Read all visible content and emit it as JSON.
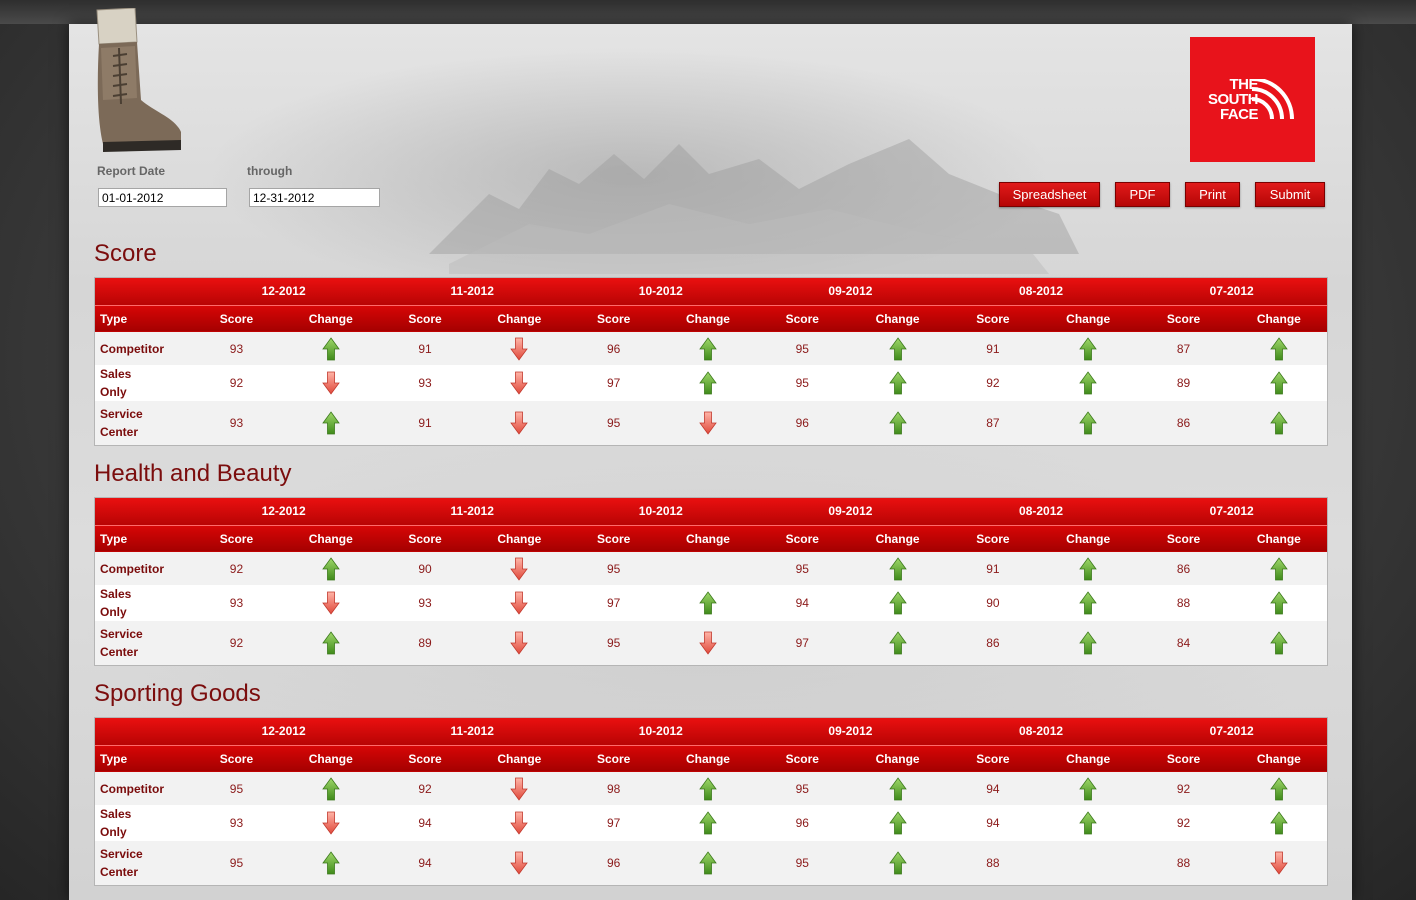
{
  "brand": {
    "logo_lines": [
      "THE",
      "SOUTH",
      "FACE"
    ],
    "color": "#e8131b"
  },
  "report": {
    "date_label": "Report Date",
    "through_label": "through",
    "start_date": "01-01-2012",
    "end_date": "12-31-2012"
  },
  "toolbar": {
    "spreadsheet": "Spreadsheet",
    "pdf": "PDF",
    "print": "Print",
    "submit": "Submit"
  },
  "columns": {
    "type": "Type",
    "score": "Score",
    "change": "Change",
    "months": [
      "12-2012",
      "11-2012",
      "10-2012",
      "09-2012",
      "08-2012",
      "07-2012"
    ]
  },
  "sections": [
    {
      "title": "Score",
      "rows": [
        {
          "type": "Competitor",
          "scores": [
            "93",
            "91",
            "96",
            "95",
            "91",
            "87"
          ],
          "changes": [
            "up",
            "down",
            "up",
            "up",
            "up",
            "up"
          ]
        },
        {
          "type": "Sales Only",
          "scores": [
            "92",
            "93",
            "97",
            "95",
            "92",
            "89"
          ],
          "changes": [
            "down",
            "down",
            "up",
            "up",
            "up",
            "up"
          ]
        },
        {
          "type": "Service Center",
          "scores": [
            "93",
            "91",
            "95",
            "96",
            "87",
            "86"
          ],
          "changes": [
            "up",
            "down",
            "down",
            "up",
            "up",
            "up"
          ]
        }
      ]
    },
    {
      "title": "Health and Beauty",
      "rows": [
        {
          "type": "Competitor",
          "scores": [
            "92",
            "90",
            "95",
            "95",
            "91",
            "86"
          ],
          "changes": [
            "up",
            "down",
            "none",
            "up",
            "up",
            "up"
          ]
        },
        {
          "type": "Sales Only",
          "scores": [
            "93",
            "93",
            "97",
            "94",
            "90",
            "88"
          ],
          "changes": [
            "down",
            "down",
            "up",
            "up",
            "up",
            "up"
          ]
        },
        {
          "type": "Service Center",
          "scores": [
            "92",
            "89",
            "95",
            "97",
            "86",
            "84"
          ],
          "changes": [
            "up",
            "down",
            "down",
            "up",
            "up",
            "up"
          ]
        }
      ]
    },
    {
      "title": "Sporting Goods",
      "rows": [
        {
          "type": "Competitor",
          "scores": [
            "95",
            "92",
            "98",
            "95",
            "94",
            "92"
          ],
          "changes": [
            "up",
            "down",
            "up",
            "up",
            "up",
            "up"
          ]
        },
        {
          "type": "Sales Only",
          "scores": [
            "93",
            "94",
            "97",
            "96",
            "94",
            "92"
          ],
          "changes": [
            "down",
            "down",
            "up",
            "up",
            "up",
            "up"
          ]
        },
        {
          "type": "Service Center",
          "scores": [
            "95",
            "94",
            "96",
            "95",
            "88",
            "88"
          ],
          "changes": [
            "up",
            "down",
            "up",
            "up",
            "none",
            "down"
          ]
        }
      ]
    }
  ],
  "colors": {
    "header_red": "#d80606",
    "title_red": "#7b0d0d",
    "up_green": "#5aa52a",
    "down_red": "#e8554a"
  }
}
